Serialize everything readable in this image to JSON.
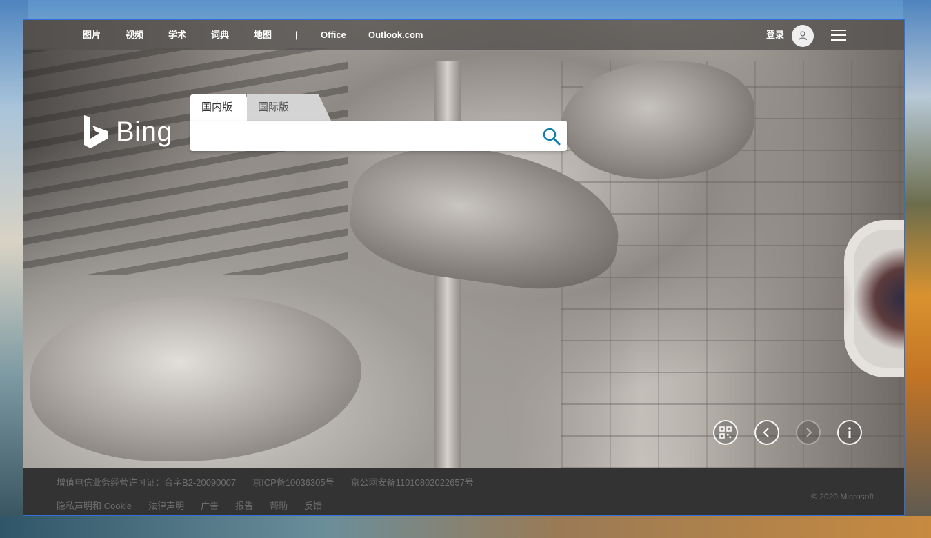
{
  "nav": {
    "items": [
      "图片",
      "视频",
      "学术",
      "词典",
      "地图"
    ],
    "separator": "|",
    "external": [
      "Office",
      "Outlook.com"
    ],
    "signin_label": "登录"
  },
  "logo": {
    "text": "Bing"
  },
  "search": {
    "tabs": [
      "国内版",
      "国际版"
    ],
    "active_tab": "国内版",
    "placeholder": "",
    "value": ""
  },
  "footer": {
    "license_links": [
      "增值电信业务经营许可证：合字B2-20090007",
      "京ICP备10036305号",
      "京公网安备11010802022657号"
    ],
    "links": [
      "隐私声明和 Cookie",
      "法律声明",
      "广告",
      "报告",
      "帮助",
      "反馈"
    ],
    "copyright": "© 2020 Microsoft"
  },
  "icons": {
    "search": "search-icon",
    "avatar": "user-icon",
    "menu": "hamburger-menu-icon",
    "qr": "qr-code-icon",
    "prev": "chevron-left-icon",
    "next": "chevron-right-icon",
    "info": "info-icon"
  },
  "colors": {
    "window_border": "#2f6fd6",
    "search_icon": "#0c7fa8",
    "footer_bg": "#333333",
    "footer_text": "#6e6e6e"
  }
}
